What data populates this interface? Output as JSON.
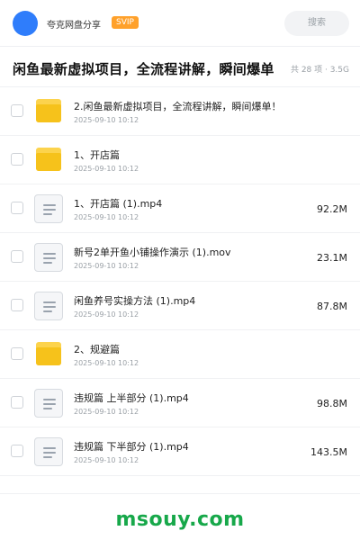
{
  "header": {
    "user_name": "夸克网盘分享",
    "badge": "SVIP",
    "search_placeholder": "搜索"
  },
  "share": {
    "title": "闲鱼最新虚拟项目，全流程讲解，瞬间爆单",
    "summary": "共 28 项 · 3.5G"
  },
  "files": [
    {
      "type": "folder",
      "icon": "folder-icon",
      "name": "2.闲鱼最新虚拟项目，全流程讲解，瞬间爆单！",
      "date": "2025-09-10 10:12",
      "size": ""
    },
    {
      "type": "folder",
      "icon": "folder-icon",
      "name": "1、开店篇",
      "date": "2025-09-10 10:12",
      "size": ""
    },
    {
      "type": "file",
      "icon": "video-file-icon",
      "name": "1、开店篇 (1).mp4",
      "date": "2025-09-10 10:12",
      "size": "92.2M"
    },
    {
      "type": "file",
      "icon": "video-file-icon",
      "name": "新号2单开鱼小铺操作演示 (1).mov",
      "date": "2025-09-10 10:12",
      "size": "23.1M"
    },
    {
      "type": "file",
      "icon": "video-file-icon",
      "name": "闲鱼养号实操方法 (1).mp4",
      "date": "2025-09-10 10:12",
      "size": "87.8M"
    },
    {
      "type": "folder",
      "icon": "folder-icon",
      "name": "2、规避篇",
      "date": "2025-09-10 10:12",
      "size": ""
    },
    {
      "type": "file",
      "icon": "video-file-icon",
      "name": "违规篇 上半部分 (1).mp4",
      "date": "2025-09-10 10:12",
      "size": "98.8M"
    },
    {
      "type": "file",
      "icon": "video-file-icon",
      "name": "违规篇 下半部分 (1).mp4",
      "date": "2025-09-10 10:12",
      "size": "143.5M"
    }
  ],
  "watermark": "msouy.com",
  "colors": {
    "accent": "#2f7dfb",
    "svip": "#ffa12b",
    "folder": "#f6c21b",
    "watermark": "#17a84a"
  }
}
